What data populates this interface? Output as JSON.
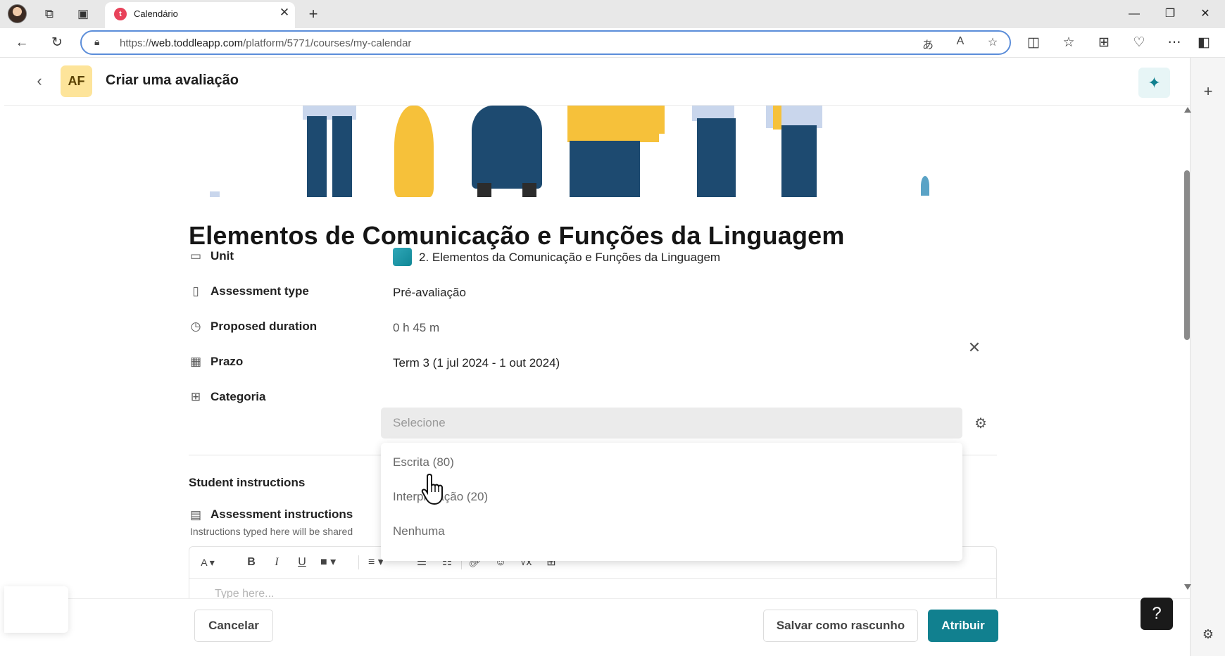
{
  "browser": {
    "tab_title": "Calendário",
    "tab_favicon_letter": "t",
    "url_prefix": "https://",
    "url_host": "web.toddleapp.com",
    "url_path": "/platform/5771/courses/my-calendar"
  },
  "header": {
    "avatar_initials": "AF",
    "title": "Criar uma avaliação"
  },
  "assessment": {
    "title": "Elementos de Comunicação e Funções da Linguagem",
    "fields": [
      {
        "label": "Unit",
        "value": "2. Elementos da Comunicação e Funções da Linguagem"
      },
      {
        "label": "Assessment type",
        "value": "Pré-avaliação"
      },
      {
        "label": "Proposed duration",
        "value": "0 h 45 m"
      },
      {
        "label": "Prazo",
        "value": "Term 3 (1 jul 2024 - 1 out 2024)"
      },
      {
        "label": "Categoria",
        "value": ""
      }
    ],
    "category_placeholder": "Selecione",
    "category_options": [
      "Escrita (80)",
      "Interpretação (20)",
      "Nenhuma"
    ]
  },
  "instructions": {
    "section_title": "Student instructions",
    "label": "Assessment instructions",
    "hint": "Instructions typed here will be shared",
    "editor_placeholder": "Type here..."
  },
  "footer": {
    "cancel": "Cancelar",
    "save_draft": "Salvar como rascunho",
    "assign": "Atribuir"
  },
  "help": {
    "label": "?"
  },
  "colors": {
    "accent": "#11808f",
    "badge": "#fde49a"
  }
}
